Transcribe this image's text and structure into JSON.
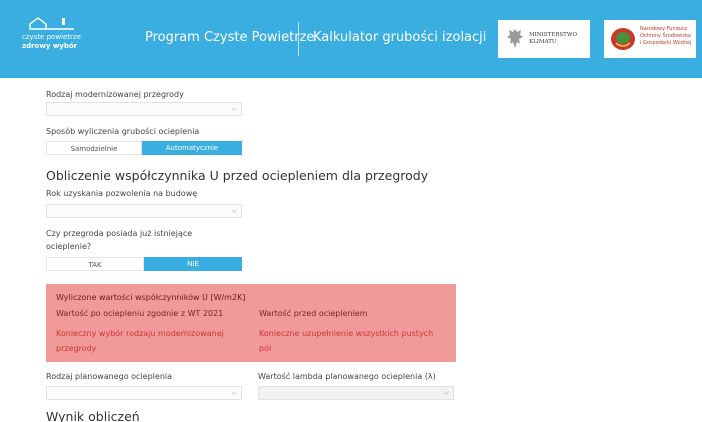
{
  "header": {
    "logo": {
      "line1": "czyste powietrze",
      "line2": "zdrowy wybór"
    },
    "title_program": "Program Czyste Powietrze",
    "title_calculator": "Kalkulator grubości izolacji",
    "ministry": {
      "line1": "MINISTERSTWO",
      "line2": "KLIMATU"
    },
    "fund": {
      "line1": "Narodowy Fundusz",
      "line2": "Ochrony Środowiska",
      "line3": "i Gospodarki Wodnej"
    }
  },
  "form": {
    "partition_type": {
      "label": "Rodzaj modernizowanej przegrody",
      "value": ""
    },
    "calc_method": {
      "label": "Sposób wyliczenia grubości ocieplenia",
      "options": [
        "Samodzielnie",
        "Automatycznie"
      ],
      "selected": "Automatycznie"
    },
    "section_before": {
      "heading": "Obliczenie współczynnika U przed ociepleniem dla przegrody"
    },
    "permit_year": {
      "label": "Rok uzyskania pozwolenia na budowę",
      "value": ""
    },
    "existing_insulation": {
      "label_line1": "Czy przegroda posiada już istniejące",
      "label_line2": "ocieplenie?",
      "options": [
        "TAK",
        "NIE"
      ],
      "selected": "NIE"
    },
    "alert": {
      "title": "Wyliczone wartości współczynników U [W/m2K]",
      "after_label": "Wartość po ociepleniu zgodnie z WT 2021",
      "after_msg": "Konieczny wybór rodzaju modernizowanej przegrody",
      "before_label": "Wartość przed ociepleniem",
      "before_msg": "Konieczne uzupełnienie wszystkich pustych pól"
    },
    "planned_insulation": {
      "label": "Rodzaj planowanego ocieplenia",
      "value": ""
    },
    "lambda": {
      "label": "Wartość lambda planowanego ocieplenia (λ)",
      "value": ""
    },
    "result_heading": "Wynik obliczeń"
  },
  "colors": {
    "brand_blue": "#3aaee0",
    "alert_bg": "#f19a9a",
    "alert_text": "#d13333"
  }
}
